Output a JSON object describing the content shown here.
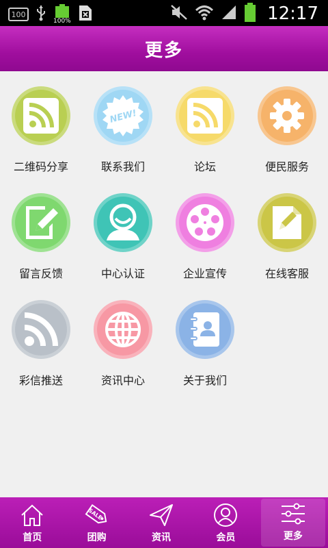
{
  "status_bar": {
    "box_text": "100",
    "battery_pct": "100%",
    "time": "12:17"
  },
  "header": {
    "title": "更多"
  },
  "grid": {
    "items": [
      {
        "label": "二维码分享",
        "icon": "rss-icon",
        "color": "#b9cf52"
      },
      {
        "label": "联系我们",
        "icon": "new-badge-icon",
        "color": "#9fd7f4",
        "badge_text": "NEW!"
      },
      {
        "label": "论坛",
        "icon": "rss-icon",
        "color": "#f6da6a"
      },
      {
        "label": "便民服务",
        "icon": "gear-icon",
        "color": "#f6b36a"
      },
      {
        "label": "留言反馈",
        "icon": "edit-note-icon",
        "color": "#7fd86f"
      },
      {
        "label": "中心认证",
        "icon": "user-icon",
        "color": "#3fc4b6"
      },
      {
        "label": "企业宣传",
        "icon": "film-reel-icon",
        "color": "#ef7fe0"
      },
      {
        "label": "在线客服",
        "icon": "document-pen-icon",
        "color": "#cbc647"
      },
      {
        "label": "彩信推送",
        "icon": "rss-icon",
        "color": "#b9c0c8"
      },
      {
        "label": "资讯中心",
        "icon": "globe-icon",
        "color": "#f798a4"
      },
      {
        "label": "关于我们",
        "icon": "contact-book-icon",
        "color": "#8bb3e6"
      }
    ]
  },
  "bottom_nav": {
    "items": [
      {
        "label": "首页",
        "icon": "home-icon"
      },
      {
        "label": "团购",
        "icon": "sale-tag-icon",
        "tag_text": "SALE"
      },
      {
        "label": "资讯",
        "icon": "paper-plane-icon"
      },
      {
        "label": "会员",
        "icon": "user-circle-icon"
      },
      {
        "label": "更多",
        "icon": "sliders-icon",
        "active": true
      }
    ]
  }
}
